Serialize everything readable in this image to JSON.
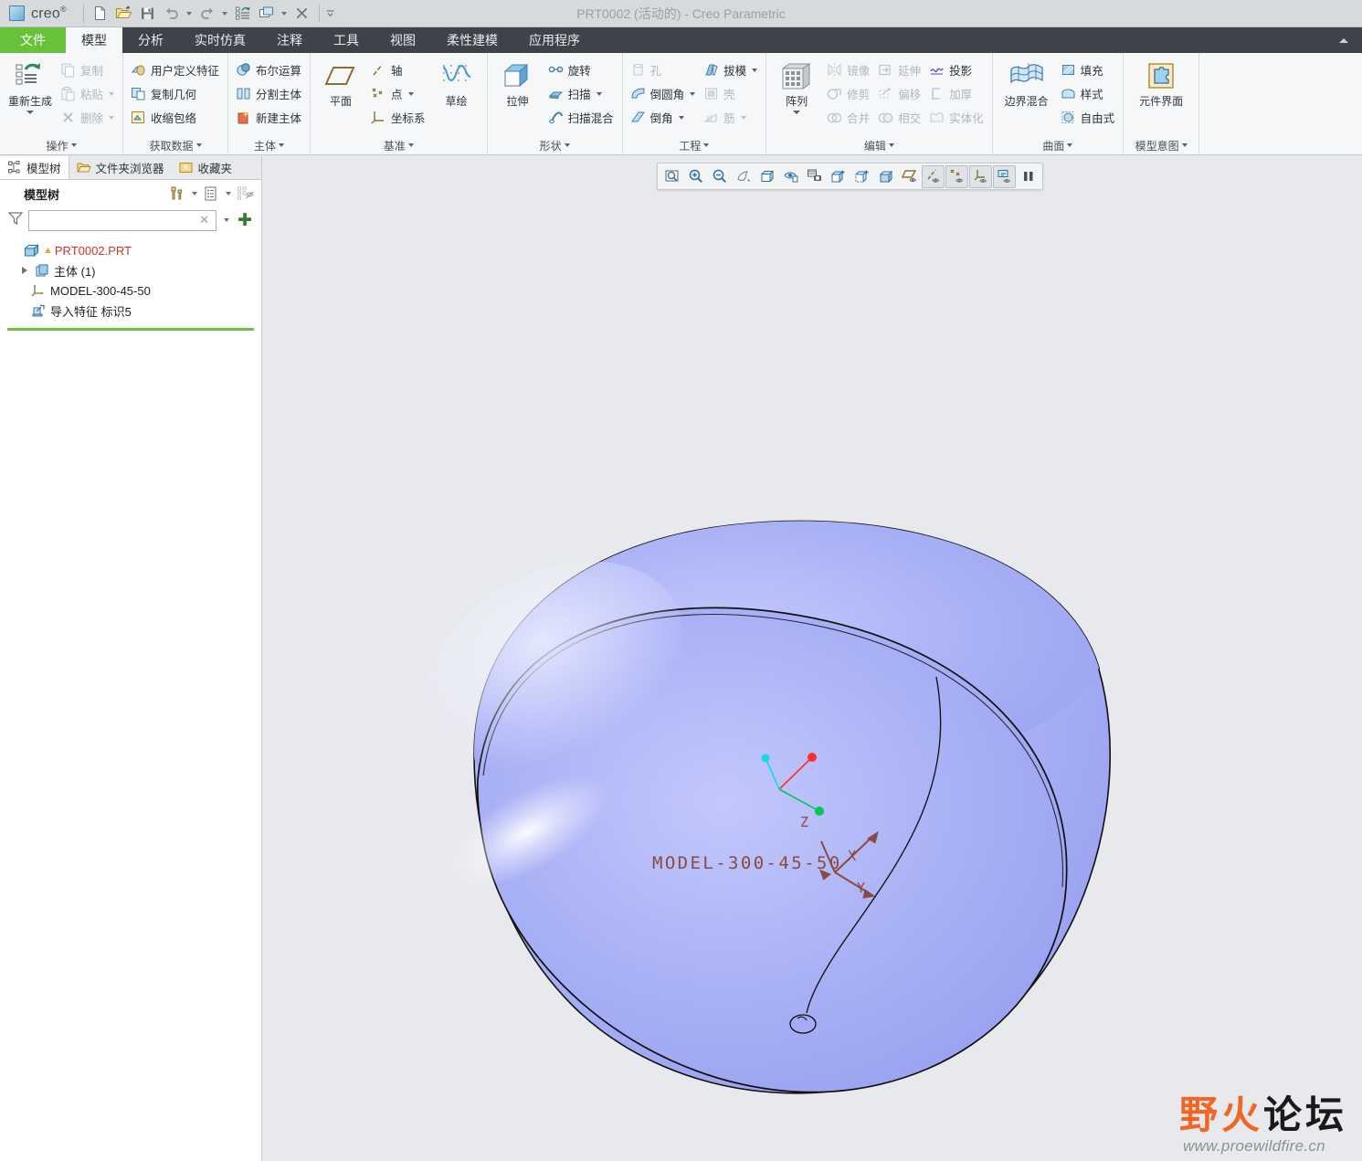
{
  "window": {
    "title": "PRT0002 (活动的) - Creo Parametric",
    "brand": "creo",
    "brand_sup": "®"
  },
  "quick_access": [
    {
      "name": "new-file-icon",
      "tip": "新建"
    },
    {
      "name": "open-file-icon",
      "tip": "打开"
    },
    {
      "name": "save-icon",
      "tip": "保存"
    },
    {
      "name": "undo-icon",
      "tip": "撤消"
    },
    {
      "name": "redo-icon",
      "tip": "重做"
    },
    {
      "name": "regenerate-icon",
      "tip": "重新生成"
    },
    {
      "name": "window-switch-icon",
      "tip": "窗口"
    },
    {
      "name": "close-window-icon",
      "tip": "关闭"
    }
  ],
  "tabs": [
    {
      "label": "文件",
      "key": "file",
      "active": false
    },
    {
      "label": "模型",
      "key": "model",
      "active": true
    },
    {
      "label": "分析",
      "key": "analysis",
      "active": false
    },
    {
      "label": "实时仿真",
      "key": "livesim",
      "active": false
    },
    {
      "label": "注释",
      "key": "annotate",
      "active": false
    },
    {
      "label": "工具",
      "key": "tools",
      "active": false
    },
    {
      "label": "视图",
      "key": "view",
      "active": false
    },
    {
      "label": "柔性建模",
      "key": "flexible",
      "active": false
    },
    {
      "label": "应用程序",
      "key": "applications",
      "active": false
    }
  ],
  "ribbon": {
    "groups": [
      {
        "label": "操作",
        "big": [
          {
            "label": "重新生成",
            "icon": "regenerate-icon",
            "caret": true,
            "disabled": false
          }
        ],
        "columns": [
          [
            {
              "label": "复制",
              "icon": "copy-icon",
              "disabled": true,
              "caret": false
            },
            {
              "label": "粘贴",
              "icon": "paste-icon",
              "disabled": true,
              "caret": true
            },
            {
              "label": "删除",
              "icon": "delete-icon",
              "disabled": true,
              "caret": true
            }
          ]
        ]
      },
      {
        "label": "获取数据",
        "big": [],
        "columns": [
          [
            {
              "label": "用户定义特征",
              "icon": "udf-icon",
              "disabled": false,
              "caret": false
            },
            {
              "label": "复制几何",
              "icon": "copy-geometry-icon",
              "disabled": false,
              "caret": false
            },
            {
              "label": "收缩包络",
              "icon": "shrinkwrap-icon",
              "disabled": false,
              "caret": false
            }
          ]
        ]
      },
      {
        "label": "主体",
        "big": [],
        "columns": [
          [
            {
              "label": "布尔运算",
              "icon": "boolean-icon",
              "disabled": false,
              "caret": false
            },
            {
              "label": "分割主体",
              "icon": "split-body-icon",
              "disabled": false,
              "caret": false
            },
            {
              "label": "新建主体",
              "icon": "new-body-icon",
              "disabled": false,
              "caret": false
            }
          ]
        ]
      },
      {
        "label": "基准",
        "big": [
          {
            "label": "平面",
            "icon": "datum-plane-icon",
            "caret": false,
            "disabled": false
          }
        ],
        "columns": [
          [
            {
              "label": "轴",
              "icon": "datum-axis-icon",
              "disabled": false,
              "caret": false
            },
            {
              "label": "点",
              "icon": "datum-point-icon",
              "disabled": false,
              "caret": true
            },
            {
              "label": "坐标系",
              "icon": "csys-icon",
              "disabled": false,
              "caret": false
            }
          ]
        ],
        "big_after": [
          {
            "label": "草绘",
            "icon": "sketch-icon",
            "caret": false,
            "disabled": false
          }
        ]
      },
      {
        "label": "形状",
        "big": [
          {
            "label": "拉伸",
            "icon": "extrude-icon",
            "caret": false,
            "disabled": false
          }
        ],
        "columns": [
          [
            {
              "label": "旋转",
              "icon": "revolve-icon",
              "disabled": false,
              "caret": false
            },
            {
              "label": "扫描",
              "icon": "sweep-icon",
              "disabled": false,
              "caret": true
            },
            {
              "label": "扫描混合",
              "icon": "swept-blend-icon",
              "disabled": false,
              "caret": false
            }
          ]
        ]
      },
      {
        "label": "工程",
        "big": [],
        "columns": [
          [
            {
              "label": "孔",
              "icon": "hole-icon",
              "disabled": true,
              "caret": false
            },
            {
              "label": "倒圆角",
              "icon": "round-icon",
              "disabled": false,
              "caret": true
            },
            {
              "label": "倒角",
              "icon": "chamfer-icon",
              "disabled": false,
              "caret": true
            }
          ],
          [
            {
              "label": "拔模",
              "icon": "draft-icon",
              "disabled": false,
              "caret": true
            },
            {
              "label": "壳",
              "icon": "shell-icon",
              "disabled": true,
              "caret": false
            },
            {
              "label": "筋",
              "icon": "rib-icon",
              "disabled": true,
              "caret": true
            }
          ]
        ]
      },
      {
        "label": "编辑",
        "big": [
          {
            "label": "阵列",
            "icon": "pattern-icon",
            "caret": true,
            "disabled": false
          }
        ],
        "columns": [
          [
            {
              "label": "镜像",
              "icon": "mirror-icon",
              "disabled": true,
              "caret": false
            },
            {
              "label": "修剪",
              "icon": "trim-icon",
              "disabled": true,
              "caret": false
            },
            {
              "label": "合并",
              "icon": "merge-icon",
              "disabled": true,
              "caret": false
            }
          ],
          [
            {
              "label": "延伸",
              "icon": "extend-icon",
              "disabled": true,
              "caret": false
            },
            {
              "label": "偏移",
              "icon": "offset-icon",
              "disabled": true,
              "caret": false
            },
            {
              "label": "相交",
              "icon": "intersect-icon",
              "disabled": true,
              "caret": false
            }
          ],
          [
            {
              "label": "投影",
              "icon": "project-icon",
              "disabled": false,
              "caret": false
            },
            {
              "label": "加厚",
              "icon": "thicken-icon",
              "disabled": true,
              "caret": false
            },
            {
              "label": "实体化",
              "icon": "solidify-icon",
              "disabled": true,
              "caret": false
            }
          ]
        ]
      },
      {
        "label": "曲面",
        "big": [
          {
            "label": "边界混合",
            "icon": "boundary-blend-icon",
            "caret": false,
            "disabled": false
          }
        ],
        "columns": [
          [
            {
              "label": "填充",
              "icon": "fill-icon",
              "disabled": false,
              "caret": false
            },
            {
              "label": "样式",
              "icon": "style-icon",
              "disabled": false,
              "caret": false
            },
            {
              "label": "自由式",
              "icon": "freestyle-icon",
              "disabled": false,
              "caret": false
            }
          ]
        ]
      },
      {
        "label": "模型意图",
        "big": [
          {
            "label": "元件界面",
            "icon": "component-interface-icon",
            "caret": false,
            "disabled": false
          }
        ],
        "columns": []
      }
    ]
  },
  "nav": {
    "tabs": [
      {
        "label": "模型树",
        "icon": "model-tree-icon",
        "active": true
      },
      {
        "label": "文件夹浏览器",
        "icon": "folder-browser-icon",
        "active": false
      },
      {
        "label": "收藏夹",
        "icon": "favorites-icon",
        "active": false
      }
    ],
    "panel_title": "模型树",
    "tools": [
      {
        "name": "settings-tools-icon",
        "caret": true
      },
      {
        "name": "display-list-icon",
        "caret": true
      },
      {
        "name": "tree-filter-hide-icon",
        "caret": false
      }
    ],
    "filter": {
      "value": "",
      "placeholder": "",
      "icon": "funnel-filter-icon",
      "clear_label": "✕",
      "add_label": "✚"
    },
    "tree": [
      {
        "label": "PRT0002.PRT",
        "icon": "part-icon",
        "indent": 0,
        "expander": "none",
        "warning": true,
        "color": "red"
      },
      {
        "label": "主体 (1)",
        "icon": "bodies-folder-icon",
        "indent": 1,
        "expander": "collapsed",
        "warning": false,
        "color": "normal"
      },
      {
        "label": "MODEL-300-45-50",
        "icon": "csys-tree-icon",
        "indent": 2,
        "expander": "none",
        "warning": false,
        "color": "normal"
      },
      {
        "label": "导入特征 标识5",
        "icon": "import-feature-icon",
        "indent": 2,
        "expander": "none",
        "warning": false,
        "color": "normal"
      }
    ]
  },
  "graphics_toolbar": [
    {
      "name": "zoom-window-icon",
      "pressed": false
    },
    {
      "name": "zoom-in-icon",
      "pressed": false
    },
    {
      "name": "zoom-out-icon",
      "pressed": false
    },
    {
      "name": "refit-icon",
      "pressed": false
    },
    {
      "name": "saved-views-icon",
      "pressed": false
    },
    {
      "name": "view-manager-icon",
      "pressed": false
    },
    {
      "name": "snapshot-icon",
      "pressed": false
    },
    {
      "name": "display-style-icon",
      "pressed": false
    },
    {
      "name": "perspective-view-icon",
      "pressed": false
    },
    {
      "name": "appearance-gallery-icon",
      "pressed": false
    },
    {
      "name": "datum-planes-visibility-icon",
      "pressed": false
    },
    {
      "name": "datum-axes-visibility-icon",
      "pressed": true
    },
    {
      "name": "datum-points-visibility-icon",
      "pressed": true
    },
    {
      "name": "csys-visibility-icon",
      "pressed": true
    },
    {
      "name": "annotations-visibility-icon",
      "pressed": true
    },
    {
      "name": "pause-icon",
      "pressed": false
    }
  ],
  "model_view": {
    "csys_label": "MODEL-300-45-50",
    "axis_labels": {
      "x": "X",
      "y": "Y",
      "z": "Z"
    },
    "colors": {
      "surface_light": "#c3c9fb",
      "surface_base": "#9fa7f3",
      "surface_dark": "#8b94ee",
      "edge": "#101010",
      "annotation": "#8a4a40",
      "axis_x": "#ff2d2d",
      "axis_y": "#00c853",
      "axis_z": "#19d7e8",
      "background": "#e8e9ed"
    }
  },
  "watermark": {
    "char1": "野",
    "char2": "火",
    "char3": "论",
    "char4": "坛",
    "url": "www.proewildfire.cn",
    "orange": "#f26522",
    "black": "#1a1a1a"
  }
}
